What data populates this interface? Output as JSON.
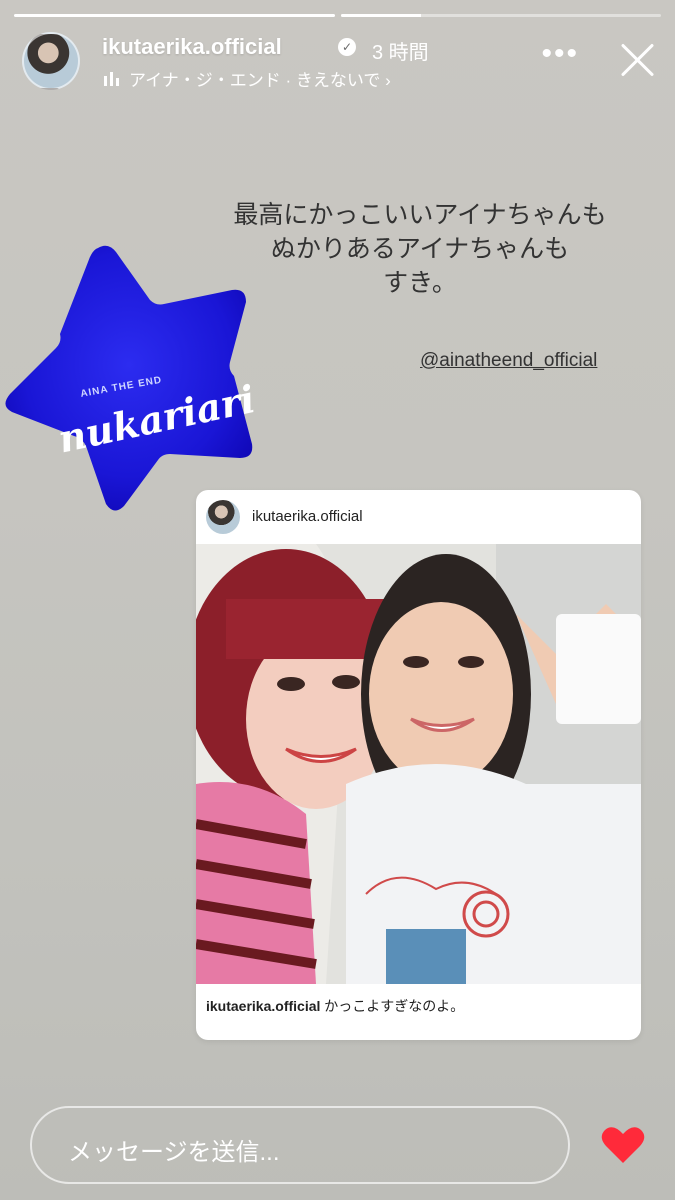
{
  "story": {
    "progress": [
      1.0,
      0.25
    ]
  },
  "header": {
    "username": "ikutaerika.official",
    "verified_icon": "verified-check-icon",
    "time": "3 時間",
    "music": "アイナ・ジ・エンド · きえないで ›",
    "more": "•••"
  },
  "caption": {
    "line1": "最高にかっこいいアイナちゃんも",
    "line2": "ぬかりあるアイナちゃんも",
    "line3": "すき。",
    "mention": "@ainatheend_official"
  },
  "sticker": {
    "brand": "AINA THE END",
    "script": "nukariari",
    "color": "#1a16d6"
  },
  "post": {
    "username": "ikutaerika.official",
    "caption_user": "ikutaerika.official",
    "caption_text": " かっこよすぎなのよ。"
  },
  "footer": {
    "message_placeholder": "メッセージを送信...",
    "heart_color": "#ff2a3a"
  }
}
